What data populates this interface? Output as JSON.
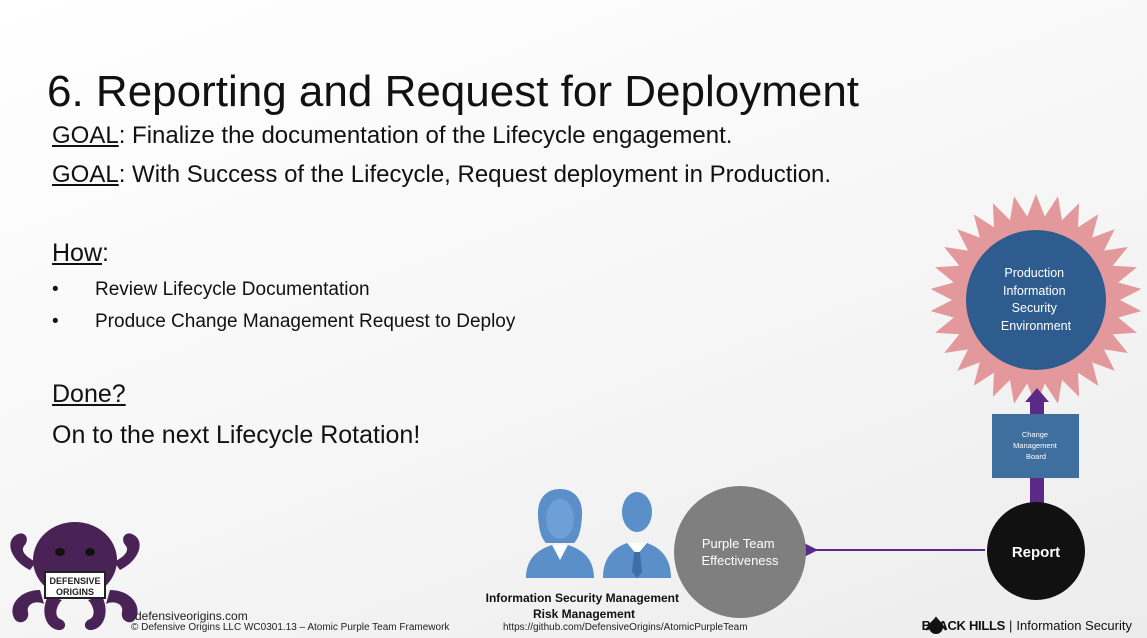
{
  "slide": {
    "title": "6. Reporting and Request for Deployment",
    "goal_label": "GOAL",
    "goal1_text": ": Finalize the documentation of the Lifecycle engagement.",
    "goal2_text": ": With Success of the Lifecycle, Request deployment in Production.",
    "how_label": "How",
    "how_colon": ":",
    "bullets": [
      "Review Lifecycle Documentation",
      "Produce Change Management Request to Deploy"
    ],
    "done_label": "Done?",
    "next_text": "On to the next Lifecycle Rotation!"
  },
  "diagram": {
    "production_lines": [
      "Production",
      "Information",
      "Security",
      "Environment"
    ],
    "change_board_lines": [
      "Change",
      "Management",
      "Board"
    ],
    "report_label": "Report",
    "purple_team_lines": [
      "Purple Team",
      "Effectiveness"
    ],
    "people_caption_lines": [
      "Information Security Management",
      "Risk Management"
    ],
    "colors": {
      "star": "#e3999b",
      "production_circle": "#2e5c8f",
      "change_board": "#3f6f9f",
      "arrow": "#5b2a86",
      "report": "#111111",
      "purple_team_circle": "#7f7f7f",
      "people": "#5b8fc9"
    }
  },
  "footer": {
    "site": "defensiveorigins.com",
    "copyright": "© Defensive Origins LLC   WC0301.13 – Atomic Purple Team Framework",
    "url": "https://github.com/DefensiveOrigins/AtomicPurpleTeam",
    "bh_bold": "BLACK HILLS",
    "bh_sep": " | ",
    "bh_rest": "Information Security",
    "logo_lines": [
      "DEFENSIVE",
      "ORIGINS"
    ]
  }
}
